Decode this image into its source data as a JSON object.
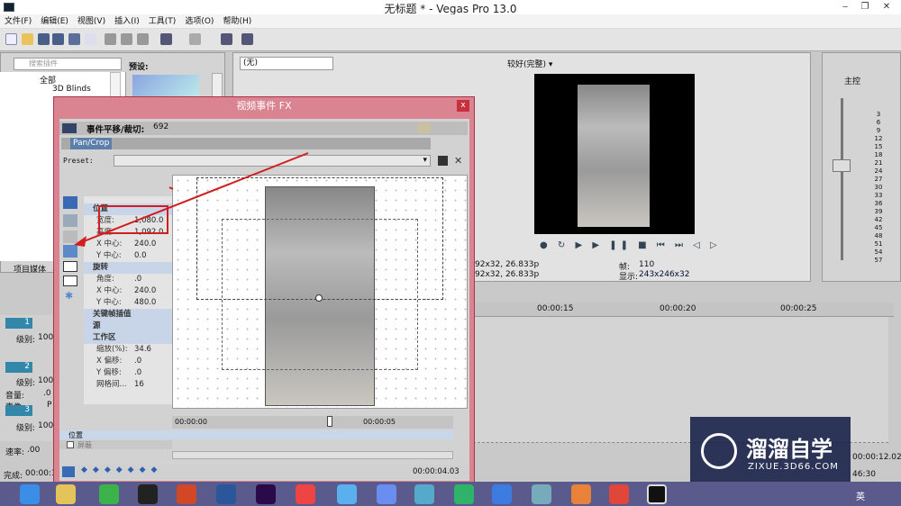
{
  "window": {
    "title": "无标题 * - Vegas Pro 13.0"
  },
  "menu": [
    "文件(F)",
    "编辑(E)",
    "视图(V)",
    "插入(I)",
    "工具(T)",
    "选项(O)",
    "帮助(H)"
  ],
  "explorer": {
    "search_placeholder": "搜索插件",
    "preset_label": "预设:",
    "tree_root": "全部",
    "tree_item": "3D Blinds",
    "tab": "项目媒体"
  },
  "preview": {
    "mode": "(无)",
    "quality": "较好(完整)",
    "frame_label": "帧:",
    "frame": "110",
    "display_label": "显示:",
    "display": "243x246x32",
    "res1": "92x32, 26.833p",
    "res2": "92x32, 26.833p"
  },
  "mixer": {
    "title": "主控",
    "levels": [
      "3",
      "6",
      "9",
      "12",
      "15",
      "18",
      "21",
      "24",
      "27",
      "30",
      "33",
      "36",
      "39",
      "42",
      "45",
      "48",
      "51",
      "54",
      "57"
    ]
  },
  "fx": {
    "title": "视频事件 FX",
    "chain": "事件平移/裁切:",
    "chain_value": "692",
    "plugin": "Pan/Crop",
    "preset_label": "Preset:",
    "timecode": "00:00:04.03",
    "tl_start": "00:00:00",
    "tl_mid": "00:00:05",
    "track_position": "位置",
    "track_mask": "屏蔽"
  },
  "props": [
    {
      "h": "位置"
    },
    {
      "k": "宽度:",
      "v": "1,080.0"
    },
    {
      "k": "高度:",
      "v": "1,092.0"
    },
    {
      "k": "X 中心:",
      "v": "240.0"
    },
    {
      "k": "Y 中心:",
      "v": "0.0"
    },
    {
      "h": "旋转"
    },
    {
      "k": "角度:",
      "v": ".0"
    },
    {
      "k": "X 中心:",
      "v": "240.0"
    },
    {
      "k": "Y 中心:",
      "v": "480.0"
    },
    {
      "h": "关键帧插值"
    },
    {
      "h": "源"
    },
    {
      "h": "工作区"
    },
    {
      "k": "缩放(%):",
      "v": "34.6"
    },
    {
      "k": "X 偏移:",
      "v": ".0"
    },
    {
      "k": "Y 偏移:",
      "v": ".0"
    },
    {
      "k": "网格间...",
      "v": "16"
    }
  ],
  "tracks": [
    {
      "num": "1",
      "level_label": "级别:",
      "level": "100"
    },
    {
      "num": "2",
      "level_label": "级别:",
      "level": "100",
      "vol_label": "音量:",
      "vol": ".0",
      "pan_label": "声像:",
      "pan": "P"
    },
    {
      "num": "3",
      "level_label": "级别:",
      "level": "100"
    }
  ],
  "timeline": {
    "ruler": [
      "00:00:15",
      "00:00:20",
      "00:00:25"
    ],
    "rate_label": "速率:",
    "rate": ".00",
    "done_label": "完成:",
    "done": "00:00:3",
    "end1": "00:00:12.02",
    "end2": "46:30"
  },
  "watermark": {
    "title": "溜溜自学",
    "url": "ZIXUE.3D66.COM"
  },
  "tray": {
    "ime": "英"
  },
  "colors": {
    "accent": "#d98490",
    "highlight": "#d21e1e",
    "watermark_bg": "#1c2a5a"
  }
}
